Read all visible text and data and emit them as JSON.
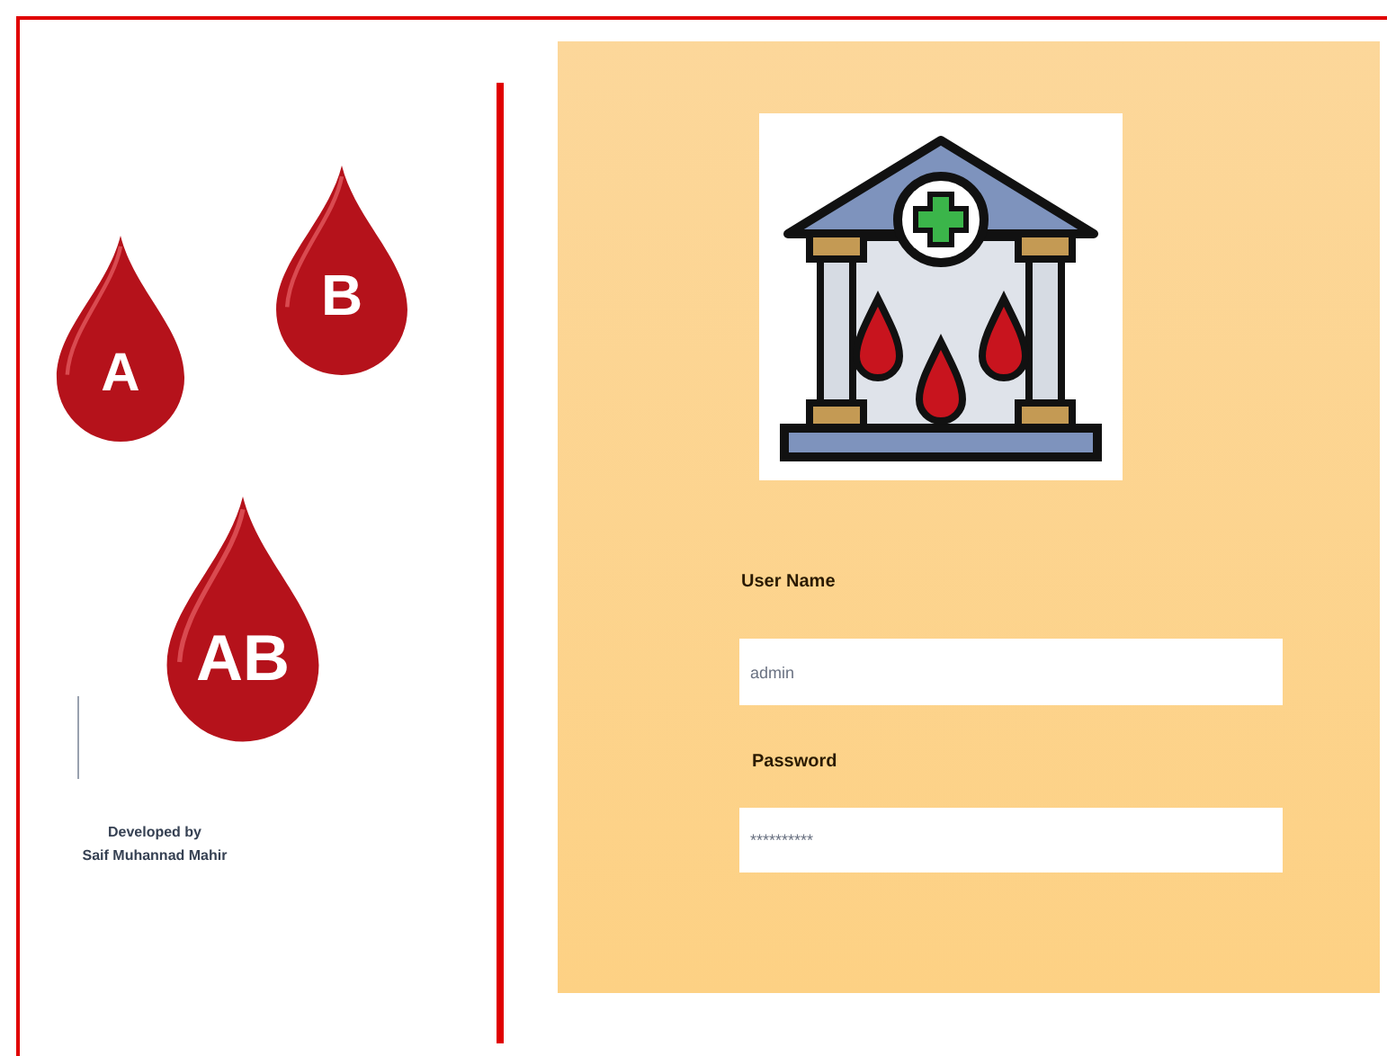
{
  "blood_types": [
    {
      "label": "A"
    },
    {
      "label": "B"
    },
    {
      "label": "AB"
    }
  ],
  "credits": {
    "line_1": "Developed by",
    "line_2": "Saif Muhannad Mahir"
  },
  "login": {
    "username_label": "User Name",
    "username_value": "admin",
    "password_label": "Password",
    "password_value": "**********"
  }
}
